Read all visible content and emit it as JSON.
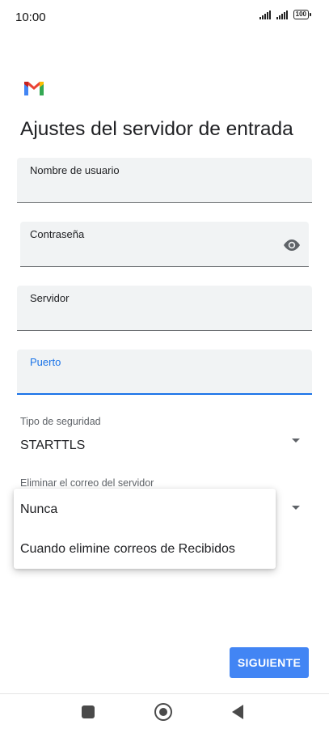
{
  "status_bar": {
    "time": "10:00",
    "battery": "100"
  },
  "page": {
    "title": "Ajustes del servidor de entrada"
  },
  "fields": {
    "username": {
      "label": "Nombre de usuario",
      "value": ""
    },
    "password": {
      "label": "Contraseña",
      "value": ""
    },
    "server": {
      "label": "Servidor",
      "value": ""
    },
    "port": {
      "label": "Puerto",
      "value": ""
    }
  },
  "security": {
    "label": "Tipo de seguridad",
    "value": "STARTTLS"
  },
  "delete_from_server": {
    "label": "Eliminar el correo del servidor",
    "options": [
      "Nunca",
      "Cuando elimine correos de Recibidos"
    ]
  },
  "actions": {
    "next": "SIGUIENTE"
  },
  "colors": {
    "accent": "#1a73e8",
    "button": "#4285f4",
    "field_bg": "#f1f3f4"
  },
  "icons": {
    "password_toggle": "eye-icon",
    "logo": "gmail-logo"
  }
}
